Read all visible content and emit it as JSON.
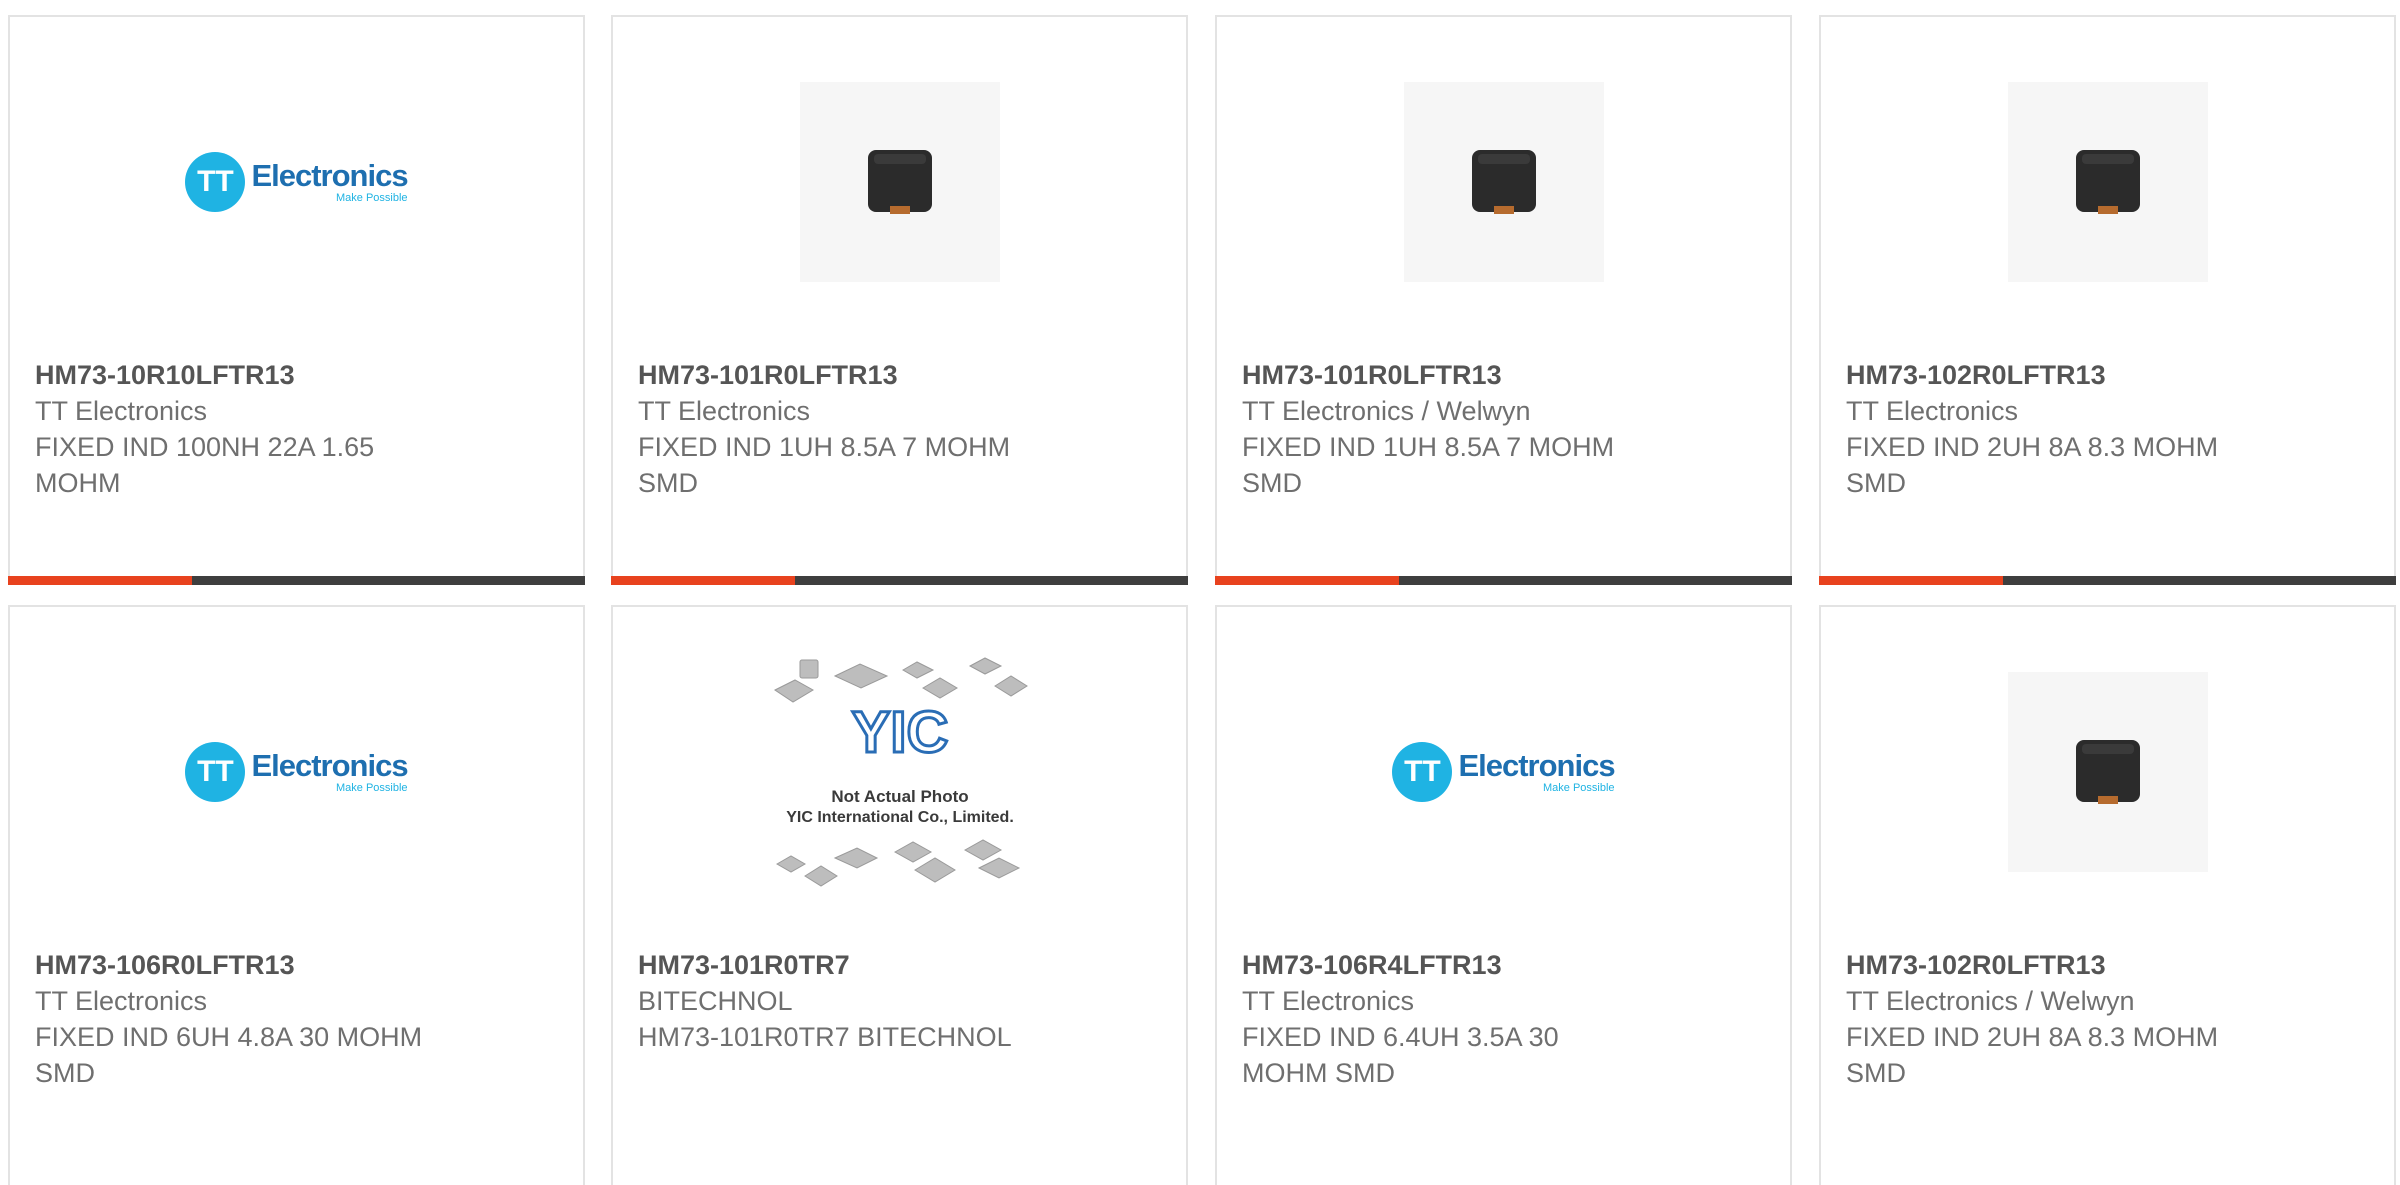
{
  "products": [
    {
      "part_number": "HM73-10R10LFTR13",
      "manufacturer": "TT Electronics",
      "description": "FIXED IND 100NH 22A 1.65 MOHM",
      "image": "tt-electronics-logo"
    },
    {
      "part_number": "HM73-101R0LFTR13",
      "manufacturer": "TT Electronics",
      "description": "FIXED IND 1UH 8.5A 7 MOHM SMD",
      "image": "inductor-photo"
    },
    {
      "part_number": "HM73-101R0LFTR13",
      "manufacturer": "TT Electronics / Welwyn",
      "description": "FIXED IND 1UH 8.5A 7 MOHM SMD",
      "image": "inductor-photo"
    },
    {
      "part_number": "HM73-102R0LFTR13",
      "manufacturer": "TT Electronics",
      "description": "FIXED IND 2UH 8A 8.3 MOHM SMD",
      "image": "inductor-photo"
    },
    {
      "part_number": "HM73-106R0LFTR13",
      "manufacturer": "TT Electronics",
      "description": "FIXED IND 6UH 4.8A 30 MOHM SMD",
      "image": "tt-electronics-logo"
    },
    {
      "part_number": "HM73-101R0TR7",
      "manufacturer": "BITECHNOL",
      "description": "HM73-101R0TR7 BITECHNOL",
      "image": "not-actual-photo"
    },
    {
      "part_number": "HM73-106R4LFTR13",
      "manufacturer": "TT Electronics",
      "description": "FIXED IND 6.4UH 3.5A 30 MOHM SMD",
      "image": "tt-electronics-logo"
    },
    {
      "part_number": "HM73-102R0LFTR13",
      "manufacturer": "TT Electronics / Welwyn",
      "description": "FIXED IND 2UH 8A 8.3 MOHM SMD",
      "image": "inductor-photo"
    }
  ],
  "logos": {
    "tt_initials": "TT",
    "tt_word": "Electronics",
    "tt_tagline": "Make Possible",
    "yic_mark": "YIC",
    "yic_line1": "Not Actual Photo",
    "yic_line2": "YIC International Co., Limited."
  },
  "colors": {
    "accent": "#e8421e",
    "bar_dark": "#3e3e3e",
    "tt_blue": "#1fb3e3"
  }
}
